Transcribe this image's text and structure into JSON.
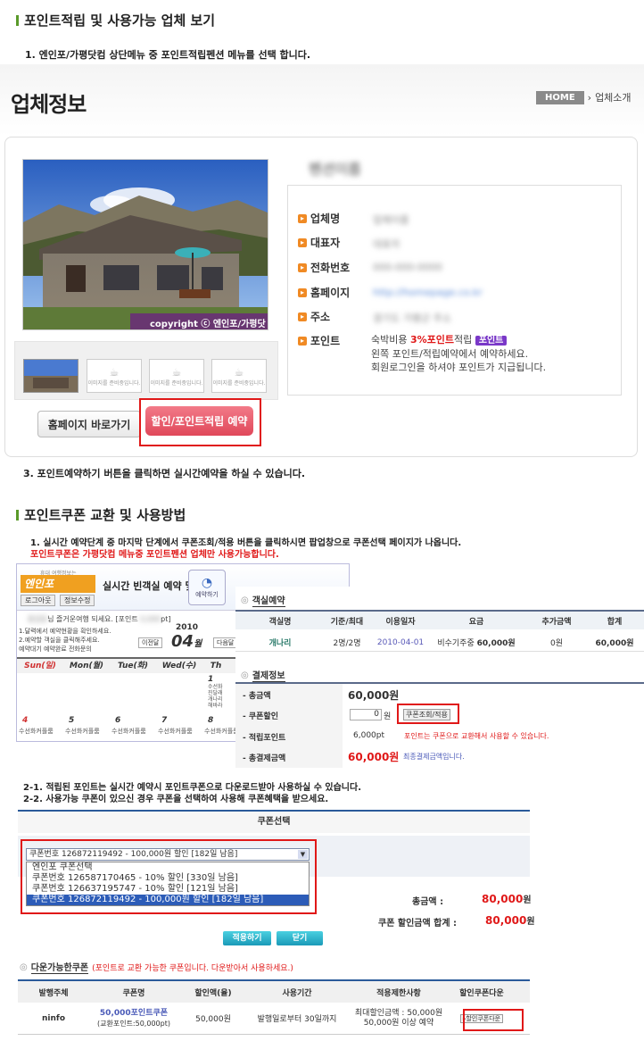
{
  "section1": {
    "title": "포인트적립 및 사용가능 업체 보기",
    "step1": "1. 엔인포/가평닷컴 상단메뉴 중 포인트적립펜션 메뉴를 선택 합니다.",
    "step3": "3. 포인트예약하기 버튼을 클릭하면 실시간예약을 하실 수 있습니다."
  },
  "page": {
    "title": "업체정보",
    "breadcrumb_home": "HOME",
    "breadcrumb_current": "업체소개",
    "photo_copyright": "copyright ⓒ 엔인포/가평닷컴",
    "business_name": "펜션이름",
    "thumb_caption": "이미지를 준비중입니다.",
    "btn_homepage": "홈페이지 바로가기",
    "btn_reserve": "할인/포인트적립 예약",
    "info": [
      {
        "label": "업체명",
        "value": "업체이름"
      },
      {
        "label": "대표자",
        "value": "대표자"
      },
      {
        "label": "전화번호",
        "value": "000-000-0000"
      },
      {
        "label": "홈페이지",
        "value": "http://homepage.co.kr"
      },
      {
        "label": "주소",
        "value": "경기도 가평군 주소"
      },
      {
        "label": "포인트",
        "value": ""
      }
    ],
    "point_line1_a": "숙박비용",
    "point_line1_red": "3%포인트",
    "point_line1_b": "적립",
    "point_badge": "포인트",
    "point_line2": "왼쪽 포인트/적립예약에서 예약하세요.",
    "point_line3": "회원로그인을 하셔야 포인트가 지급됩니다."
  },
  "section2": {
    "title": "포인트쿠폰 교환 및 사용방법",
    "step1": "1. 실시간 예약단계 중 마지막 단계에서 쿠폰조회/적용 버튼을 클릭하시면 팝업창으로 쿠폰선택 페이지가 나옵니다.",
    "step1_note": "포인트쿠폰은 가평닷컴 메뉴중 포인트펜션 업체만 사용가능합니다.",
    "step2_1": "2-1. 적립된 포인트는 실시간 예약시 포인트쿠폰으로 다운로드받아 사용하실 수 있습니다.",
    "step2_2": "2-2. 사용가능 쿠폰이 있으신 경우 쿠폰을 선택하여 사용해 쿠폰혜택을 받으세요."
  },
  "rsv": {
    "logo_small": "휴대 여행정보는",
    "logo_text": "엔인포",
    "win_title": "실시간 빈객실 예약 및 현황",
    "btn_login": "로그아웃",
    "btn_info": "정보수정",
    "welcome": "님 즐거운여행 되세요. [포인트",
    "welcome_pt": "pt]",
    "btn_reserve_icon": "예약하기",
    "guide1": "1.달력에서 예약현황을 확인하세요.",
    "guide2": "2.예약할 객실을 클릭해주세요.",
    "legend": "예약대기  예약완료  전화문의",
    "prev_month": "이전달",
    "next_month": "다음달",
    "year": "2010",
    "month": "04",
    "month_suffix": "월",
    "days": [
      "Sun(일)",
      "Mon(월)",
      "Tue(화)",
      "Wed(수)",
      "Th"
    ],
    "date1": "1",
    "date_row2": [
      "4",
      "5",
      "6",
      "7",
      "8"
    ],
    "cell_text": "수선화커플룸",
    "side_items": [
      "수선화",
      "진달래",
      "개나리",
      "해바라"
    ],
    "sec_reserve": "객실예약",
    "sec_payment": "결제정보",
    "rt_headers": [
      "객실명",
      "기준/최대",
      "이용일자",
      "요금",
      "추가금액",
      "합계"
    ],
    "rt_row": [
      "개나리",
      "2명/2명",
      "2010-04-01",
      "비수기주중",
      "60,000원",
      "0원",
      "60,000원"
    ],
    "pay_total_label": "- 총금액",
    "pay_total": "60,000원",
    "pay_coupon_label": "- 쿠폰할인",
    "pay_coupon_value": "0",
    "pay_coupon_unit": "원",
    "pay_coupon_btn": "쿠폰조회/적용",
    "pay_point_label": "- 적립포인트",
    "pay_point": "6,000pt",
    "pay_point_note": "포인트는 쿠폰으로 교환해서 사용할 수 있습니다.",
    "pay_final_label": "- 총결제금액",
    "pay_final": "60,000원",
    "pay_final_note": "최종결제금액입니다."
  },
  "coupon": {
    "title": "쿠폰선택",
    "selected": "쿠폰번호 126872119492 - 100,000원 할인 [182일 남음]",
    "options": [
      "엔인포 쿠폰선택",
      "쿠폰번호 126587170465 - 10% 할인 [330일 남음]",
      "쿠폰번호 126637195747 - 10% 할인 [121일 남음]",
      "쿠폰번호 126872119492 - 100,000원 할인 [182일 남음]"
    ],
    "total_label": "총금액 :",
    "total_value": "80,000",
    "total_unit": "원",
    "disc_label": "쿠폰 할인금액 합계 :",
    "disc_value": "80,000",
    "disc_unit": "원",
    "btn_apply": "적용하기",
    "btn_close": "닫기",
    "dl_title": "다운가능한쿠폰",
    "dl_desc": "(포인트로 교환 가능한 쿠폰입니다. 다운받아서 사용하세요.)",
    "dl_headers": [
      "발행주체",
      "쿠폰명",
      "할인액(율)",
      "사용기간",
      "적용제한사항",
      "할인쿠폰다운"
    ],
    "dl_row": {
      "issuer": "ninfo",
      "name": "50,000포인트쿠폰",
      "name_sub": "(교환포인트:50,000pt)",
      "amount": "50,000원",
      "period": "발행일로부터 30일까지",
      "limit1": "최대할인금액 : 50,000원",
      "limit2": "50,000원 이상 예약",
      "download": "▸할인쿠폰다운"
    }
  },
  "colors": {
    "accent_green": "#5a9a2a",
    "highlight_red": "#e01818",
    "button_pink": "#e0485a",
    "point_purple": "#7a38c8"
  }
}
